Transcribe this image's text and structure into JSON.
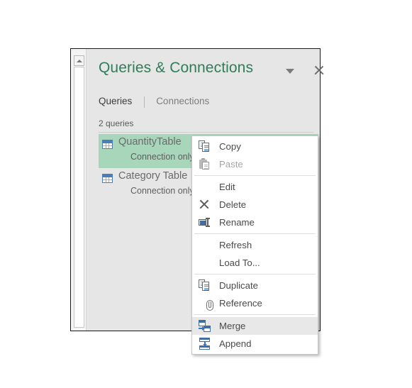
{
  "panel": {
    "title": "Queries & Connections",
    "caret_icon": "chevron-down-icon",
    "close_icon": "close-icon",
    "tabs": [
      {
        "label": "Queries",
        "active": true
      },
      {
        "label": "Connections",
        "active": false
      }
    ],
    "query_count_text": "2 queries",
    "queries": [
      {
        "name": "QuantityTable",
        "status": "Connection only.",
        "selected": true,
        "icon": "table-icon"
      },
      {
        "name": "Category Table",
        "status": "Connection only.",
        "selected": false,
        "icon": "table-icon"
      }
    ],
    "scrollbar": {
      "up_arrow_icon": "scroll-up-arrow-icon"
    }
  },
  "context_menu": {
    "groups": [
      {
        "items": [
          {
            "label": "Copy",
            "icon": "copy-icon",
            "disabled": false,
            "hovered": false
          },
          {
            "label": "Paste",
            "icon": "paste-icon",
            "disabled": true,
            "hovered": false
          }
        ]
      },
      {
        "items": [
          {
            "label": "Edit",
            "icon": "",
            "disabled": false,
            "hovered": false
          },
          {
            "label": "Delete",
            "icon": "delete-icon",
            "disabled": false,
            "hovered": false
          },
          {
            "label": "Rename",
            "icon": "rename-icon",
            "disabled": false,
            "hovered": false
          }
        ]
      },
      {
        "items": [
          {
            "label": "Refresh",
            "icon": "",
            "disabled": false,
            "hovered": false
          },
          {
            "label": "Load To...",
            "icon": "",
            "disabled": false,
            "hovered": false
          }
        ]
      },
      {
        "items": [
          {
            "label": "Duplicate",
            "icon": "duplicate-icon",
            "disabled": false,
            "hovered": false
          },
          {
            "label": "Reference",
            "icon": "reference-icon",
            "disabled": false,
            "hovered": false
          }
        ]
      },
      {
        "items": [
          {
            "label": "Merge",
            "icon": "merge-icon",
            "disabled": false,
            "hovered": true
          },
          {
            "label": "Append",
            "icon": "append-icon",
            "disabled": false,
            "hovered": false
          }
        ]
      }
    ]
  },
  "colors": {
    "brand_green": "#2e7d5b",
    "selection_green": "#a8d6ba",
    "menu_hover": "#e8e8e8",
    "panel_bg": "#e6e6e6",
    "icon_blue": "#3f6fa8"
  }
}
